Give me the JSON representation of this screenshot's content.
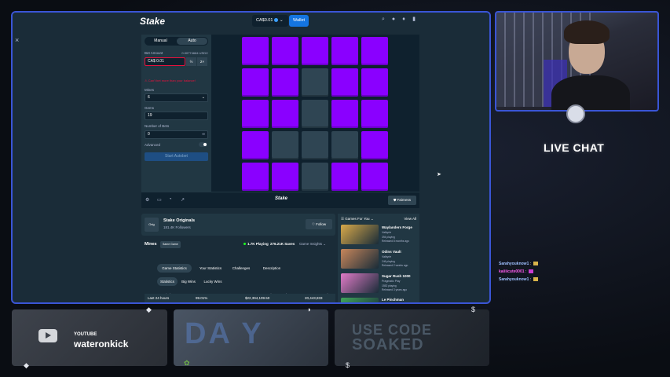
{
  "browser": {
    "logo": "Stake",
    "balance": "CA$0.01",
    "wallet_label": "Wallet",
    "icons": [
      "search-icon",
      "user-icon",
      "bell-icon",
      "sidebar-icon"
    ]
  },
  "controls": {
    "tab_manual": "Manual",
    "tab_auto": "Auto",
    "bet_amount_label": "Bet Amount",
    "bet_amount_usd": "0.00774684 USDC",
    "bet_amount_value": "CA$ 0.01",
    "half_label": "½",
    "double_label": "2×",
    "warning": "Can't bet more than your balance!",
    "mines_label": "Mines",
    "mines_value": "6",
    "gems_label": "Gems",
    "gems_value": "19",
    "bets_label": "Number of Bets",
    "bets_value": "0",
    "advanced_label": "Advanced",
    "start_label": "Start Autobet"
  },
  "board": {
    "tiles": [
      "gem",
      "gem",
      "gem",
      "gem",
      "gem",
      "gem",
      "gem",
      "hidden",
      "gem",
      "gem",
      "gem",
      "gem",
      "hidden",
      "gem",
      "gem",
      "gem",
      "hidden",
      "hidden",
      "hidden",
      "gem",
      "gem",
      "gem",
      "hidden",
      "gem",
      "gem"
    ],
    "gem_color": "#8a00ff",
    "hidden_color": "#2f4553"
  },
  "bar": {
    "logo": "Stake",
    "fairness_label": "Fairness"
  },
  "info": {
    "avatar": "Orig",
    "title": "Stake Originals",
    "followers": "181.4K Followers",
    "follow_label": "Follow",
    "game_name": "Mines",
    "same_game": "Same Game",
    "playing": "1.7K Playing",
    "saves": "276.21K Saves",
    "insights": "Game Insights",
    "tabs": [
      "Game Statistics",
      "Your Statistics",
      "Challenges",
      "Description"
    ],
    "sub_tabs": [
      "Statistics",
      "Big Wins",
      "Lucky Wins"
    ],
    "columns": [
      "Period",
      "RTP",
      "Total Wagered",
      "Total Bets"
    ],
    "row": [
      "Last 24 hours",
      "99.01%",
      "$22,394,109.50",
      "20,443,833"
    ]
  },
  "games": {
    "heading": "Games For You",
    "view_all": "View All",
    "items": [
      {
        "title": "Waylanders Forge",
        "provider": "Valkyrie",
        "stat": "394 playing",
        "release": "Released 8 months ago",
        "color": "#d8a94a"
      },
      {
        "title": "Odins Vault",
        "provider": "Valkyrie",
        "stat": "246 playing",
        "release": "Released 2 weeks ago",
        "color": "#c7865b"
      },
      {
        "title": "Sugar Rush 1000",
        "provider": "Pragmatic Play",
        "stat": "1552 playing",
        "release": "Released 3 years ago",
        "color": "#e07bc7"
      },
      {
        "title": "Le Pinchman",
        "provider": "",
        "stat": "",
        "release": "",
        "color": "#3fa55a"
      }
    ]
  },
  "overlay": {
    "live_chat": "LIVE CHAT",
    "chat": [
      {
        "name": "Sarahyouknow1",
        "text": ":",
        "color": "#9fc0ff",
        "emote": "#d9b44a"
      },
      {
        "name": "kaiiiicute0001",
        "text": ":",
        "color": "#ff5cf0",
        "emote": "#c93ccf"
      },
      {
        "name": "Sarahyouknow1",
        "text": ":",
        "color": "#9fc0ff",
        "emote": "#d9b44a"
      }
    ],
    "yt_label": "YOUTUBE",
    "yt_handle": "wateronkick",
    "daily_text": "DA  Y",
    "code_line1": "USE CODE",
    "code_line2": "SOAKED"
  }
}
